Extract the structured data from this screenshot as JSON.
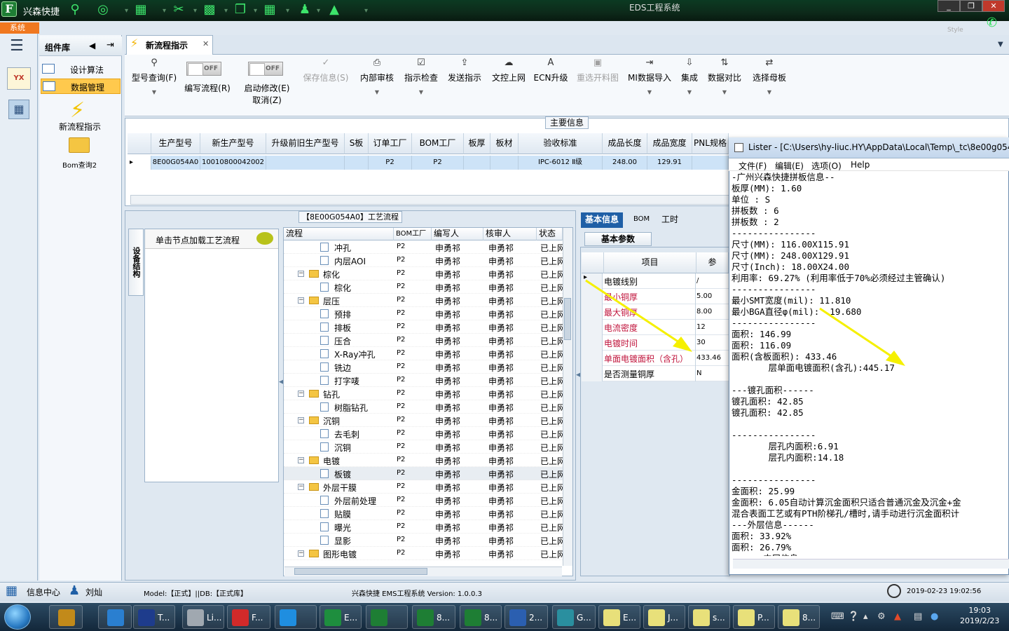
{
  "app": {
    "name": "兴森快捷",
    "window_title": "EDS工程系统",
    "system_tab": "系统",
    "style_label": "Style",
    "win_buttons": [
      "_",
      "❐",
      "✕"
    ]
  },
  "component_library": {
    "title": "组件库",
    "items": [
      {
        "label": "设计算法",
        "selected": false
      },
      {
        "label": "数据管理",
        "selected": true
      }
    ],
    "new_flow_label": "新流程指示",
    "bom_query_label": "Bom查询2"
  },
  "doc_tab": {
    "label": "新流程指示",
    "close": "✕"
  },
  "ribbon": {
    "model_query": "型号查询(F)",
    "toggle1": {
      "state": "OFF",
      "label": "编写流程(R)"
    },
    "toggle2": {
      "state": "OFF",
      "label1": "启动修改(E)",
      "label2": "取消(Z)"
    },
    "save_info": "保存信息(S)",
    "internal_review": "内部审核",
    "instruction_check": "指示检查",
    "send_instruction": "发送指示",
    "upload_doc": "文控上网",
    "ecn_upgrade": "ECN升级",
    "reselect_drawing": "重选开料图",
    "mi_import": "MI数据导入",
    "integrate": "集成",
    "data_compare": "数据对比",
    "select_mother_board": "选择母板"
  },
  "main_info": {
    "title": "主要信息",
    "columns": [
      "生产型号",
      "新生产型号",
      "升级前旧生产型号",
      "S板",
      "订单工厂",
      "BOM工厂",
      "板厚",
      "板材",
      "验收标准",
      "成品长度",
      "成品宽度",
      "PNL规格"
    ],
    "row": [
      "8E00G054A0",
      "10010800042002",
      "",
      "",
      "P2",
      "P2",
      "",
      "",
      "IPC-6012 Ⅱ级",
      "248.00",
      "129.91",
      ""
    ]
  },
  "process": {
    "title": "【8E00G054A0】工艺流程",
    "device_tab": "设备结构",
    "node_hint": "单击节点加载工艺流程",
    "columns": [
      "流程",
      "BOM工厂",
      "编写人",
      "核审人",
      "状态"
    ],
    "rows": [
      {
        "name": "冲孔",
        "level": 2,
        "type": "doc",
        "bom": "P2",
        "writer": "申勇祁",
        "reviewer": "申勇祁",
        "status": "已上网"
      },
      {
        "name": "内层AOI",
        "level": 2,
        "type": "doc",
        "bom": "P2",
        "writer": "申勇祁",
        "reviewer": "申勇祁",
        "status": "已上网"
      },
      {
        "name": "棕化",
        "level": 1,
        "type": "folder",
        "bom": "P2",
        "writer": "申勇祁",
        "reviewer": "申勇祁",
        "status": "已上网"
      },
      {
        "name": "棕化",
        "level": 2,
        "type": "doc",
        "bom": "P2",
        "writer": "申勇祁",
        "reviewer": "申勇祁",
        "status": "已上网"
      },
      {
        "name": "层压",
        "level": 1,
        "type": "folder",
        "bom": "P2",
        "writer": "申勇祁",
        "reviewer": "申勇祁",
        "status": "已上网"
      },
      {
        "name": "预排",
        "level": 2,
        "type": "doc",
        "bom": "P2",
        "writer": "申勇祁",
        "reviewer": "申勇祁",
        "status": "已上网"
      },
      {
        "name": "排板",
        "level": 2,
        "type": "doc",
        "bom": "P2",
        "writer": "申勇祁",
        "reviewer": "申勇祁",
        "status": "已上网"
      },
      {
        "name": "压合",
        "level": 2,
        "type": "doc",
        "bom": "P2",
        "writer": "申勇祁",
        "reviewer": "申勇祁",
        "status": "已上网"
      },
      {
        "name": "X-Ray冲孔",
        "level": 2,
        "type": "doc",
        "bom": "P2",
        "writer": "申勇祁",
        "reviewer": "申勇祁",
        "status": "已上网"
      },
      {
        "name": "铣边",
        "level": 2,
        "type": "doc",
        "bom": "P2",
        "writer": "申勇祁",
        "reviewer": "申勇祁",
        "status": "已上网"
      },
      {
        "name": "打字唛",
        "level": 2,
        "type": "doc",
        "bom": "P2",
        "writer": "申勇祁",
        "reviewer": "申勇祁",
        "status": "已上网"
      },
      {
        "name": "钻孔",
        "level": 1,
        "type": "folder",
        "bom": "P2",
        "writer": "申勇祁",
        "reviewer": "申勇祁",
        "status": "已上网"
      },
      {
        "name": "树脂钻孔",
        "level": 2,
        "type": "doc",
        "bom": "P2",
        "writer": "申勇祁",
        "reviewer": "申勇祁",
        "status": "已上网"
      },
      {
        "name": "沉铜",
        "level": 1,
        "type": "folder",
        "bom": "P2",
        "writer": "申勇祁",
        "reviewer": "申勇祁",
        "status": "已上网"
      },
      {
        "name": "去毛刺",
        "level": 2,
        "type": "doc",
        "bom": "P2",
        "writer": "申勇祁",
        "reviewer": "申勇祁",
        "status": "已上网"
      },
      {
        "name": "沉铜",
        "level": 2,
        "type": "doc",
        "bom": "P2",
        "writer": "申勇祁",
        "reviewer": "申勇祁",
        "status": "已上网"
      },
      {
        "name": "电镀",
        "level": 1,
        "type": "folder",
        "bom": "P2",
        "writer": "申勇祁",
        "reviewer": "申勇祁",
        "status": "已上网"
      },
      {
        "name": "板镀",
        "level": 2,
        "type": "doc",
        "bom": "P2",
        "writer": "申勇祁",
        "reviewer": "申勇祁",
        "status": "已上网",
        "selected": true
      },
      {
        "name": "外层干膜",
        "level": 1,
        "type": "folder",
        "bom": "P2",
        "writer": "申勇祁",
        "reviewer": "申勇祁",
        "status": "已上网"
      },
      {
        "name": "外层前处理",
        "level": 2,
        "type": "doc",
        "bom": "P2",
        "writer": "申勇祁",
        "reviewer": "申勇祁",
        "status": "已上网"
      },
      {
        "name": "贴膜",
        "level": 2,
        "type": "doc",
        "bom": "P2",
        "writer": "申勇祁",
        "reviewer": "申勇祁",
        "status": "已上网"
      },
      {
        "name": "曝光",
        "level": 2,
        "type": "doc",
        "bom": "P2",
        "writer": "申勇祁",
        "reviewer": "申勇祁",
        "status": "已上网"
      },
      {
        "name": "显影",
        "level": 2,
        "type": "doc",
        "bom": "P2",
        "writer": "申勇祁",
        "reviewer": "申勇祁",
        "status": "已上网"
      },
      {
        "name": "图形电镀",
        "level": 1,
        "type": "folder",
        "bom": "P2",
        "writer": "申勇祁",
        "reviewer": "申勇祁",
        "status": "已上网"
      }
    ]
  },
  "params": {
    "tabs": [
      "基本信息",
      "BOM",
      "工时"
    ],
    "sub_tab": "基本参数",
    "col_item": "项目",
    "col_value": "参",
    "rows": [
      {
        "key": "电镀线别",
        "value": "/",
        "red": false
      },
      {
        "key": "最小铜厚",
        "value": "5.00",
        "red": true
      },
      {
        "key": "最大铜厚",
        "value": "8.00",
        "red": true
      },
      {
        "key": "电流密度",
        "value": "12",
        "red": true
      },
      {
        "key": "电镀时间",
        "value": "30",
        "red": true
      },
      {
        "key": "单面电镀面积（含孔）",
        "value": "433.46",
        "red": true
      },
      {
        "key": "是否测量铜厚",
        "value": "N",
        "red": false
      }
    ]
  },
  "lister": {
    "title": "Lister - [C:\\Users\\hy-liuc.HY\\AppData\\Local\\Temp\\_tc\\8e00g054",
    "menu": [
      "文件(F)",
      "编辑(E)",
      "选项(O)",
      "Help"
    ],
    "lines": [
      "-广州兴森快捷拼板信息--",
      "板厚(MM): 1.60",
      "单位 : S",
      "拼板数 : 6",
      "拼板数 : 2",
      "----------------",
      "尺寸(MM): 116.00X115.91",
      "尺寸(MM): 248.00X129.91",
      "尺寸(Inch): 18.00X24.00",
      "利用率: 69.27% (利用率低于70%必须经过主管确认)",
      "----------------",
      "最小SMT宽度(mil): 11.810",
      "最小BGA直径φ(mil):  19.680",
      "----------------",
      "面积: 146.99",
      "面积: 116.09",
      "面积(含板面积): 433.46",
      "       层单面电镀面积(含孔):445.17",
      "",
      "---镀孔面积------",
      "镀孔面积: 42.85",
      "镀孔面积: 42.85",
      "",
      "----------------",
      "       层孔内面积:6.91",
      "       层孔内面积:14.18",
      "",
      "----------------",
      "金面积: 25.99",
      "金面积: 6.05自动计算沉金面积只适合普通沉金及沉金+金",
      "混合表面工艺或有PTH阶梯孔/槽时,请手动进行沉金面积计",
      "---外层信息------",
      "面积: 33.92%",
      "面积: 26.79%",
      "      内层信息"
    ]
  },
  "statusbar": {
    "info_center": "信息中心",
    "user": "刘灿",
    "model": "Model:【正式】||DB:【正式库】",
    "version": "兴森快捷  EMS工程系统  Version: 1.0.0.3",
    "datetime": "2019-02-23 19:02:56"
  },
  "taskbar": {
    "items": [
      {
        "label": "T...",
        "color": "#1e3c8c"
      },
      {
        "label": "Li...",
        "color": "#a0a8b0"
      },
      {
        "label": "F...",
        "color": "#d22a2a"
      },
      {
        "label": "",
        "color": "#1f8ee0"
      },
      {
        "label": "E...",
        "color": "#1e8e3e"
      },
      {
        "label": "",
        "color": "#1e7e34"
      },
      {
        "label": "8...",
        "color": "#1e7e34"
      },
      {
        "label": "8...",
        "color": "#1e7e34"
      },
      {
        "label": "2...",
        "color": "#2b5fb0"
      },
      {
        "label": "G...",
        "color": "#2a8f9f"
      },
      {
        "label": "E...",
        "color": "#e8e07a"
      },
      {
        "label": "J...",
        "color": "#e8e07a"
      },
      {
        "label": "s...",
        "color": "#e8e07a"
      },
      {
        "label": "P...",
        "color": "#e8e07a"
      },
      {
        "label": "8...",
        "color": "#e8e07a"
      }
    ],
    "time": "19:03",
    "date": "2019/2/23"
  }
}
